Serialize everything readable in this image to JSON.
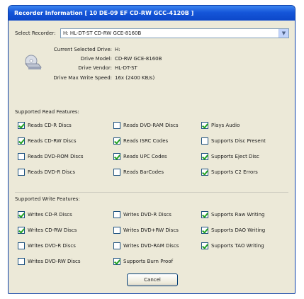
{
  "window": {
    "title": "Recorder Information [ 10 DE-09 EF CD-RW GCC-4120B ]"
  },
  "recorder_select": {
    "label": "Select Recorder:",
    "value": "H: HL-DT-ST CD-RW GCE-8160B"
  },
  "drive_info": [
    {
      "key": "Current Selected Drive:",
      "value": "H:"
    },
    {
      "key": "Drive Model:",
      "value": "CD-RW GCE-8160B"
    },
    {
      "key": "Drive Vendor:",
      "value": "HL-DT-ST"
    },
    {
      "key": "Drive Max Write Speed:",
      "value": "16x (2400 KB/s)"
    }
  ],
  "read_features": {
    "title": "Supported Read Features:",
    "items": [
      {
        "label": "Reads CD-R Discs",
        "checked": true
      },
      {
        "label": "Reads DVD-RAM Discs",
        "checked": false
      },
      {
        "label": "Plays Audio",
        "checked": true
      },
      {
        "label": "Reads CD-RW Discs",
        "checked": true
      },
      {
        "label": "Reads ISRC Codes",
        "checked": true
      },
      {
        "label": "Supports Disc Present",
        "checked": false
      },
      {
        "label": "Reads DVD-ROM Discs",
        "checked": false
      },
      {
        "label": "Reads UPC Codes",
        "checked": true
      },
      {
        "label": "Supports Eject Disc",
        "checked": true
      },
      {
        "label": "Reads DVD-R Discs",
        "checked": false
      },
      {
        "label": "Reads BarCodes",
        "checked": false
      },
      {
        "label": "Supports C2 Errors",
        "checked": true
      }
    ]
  },
  "write_features": {
    "title": "Supported Write Features:",
    "items": [
      {
        "label": "Writes CD-R Discs",
        "checked": true
      },
      {
        "label": "Writes DVD-R Discs",
        "checked": false
      },
      {
        "label": "Supports Raw Writing",
        "checked": true
      },
      {
        "label": "Writes CD-RW Discs",
        "checked": true
      },
      {
        "label": "Writes DVD+RW Discs",
        "checked": false
      },
      {
        "label": "Supports DAO Writing",
        "checked": true
      },
      {
        "label": "Writes DVD-R Discs",
        "checked": false
      },
      {
        "label": "Writes DVD-RAM Discs",
        "checked": false
      },
      {
        "label": "Supports TAO Writing",
        "checked": true
      },
      {
        "label": "Writes DVD-RW Discs",
        "checked": false
      },
      {
        "label": "Supports Burn Proof",
        "checked": true
      }
    ]
  },
  "buttons": {
    "cancel": "Cancel"
  }
}
